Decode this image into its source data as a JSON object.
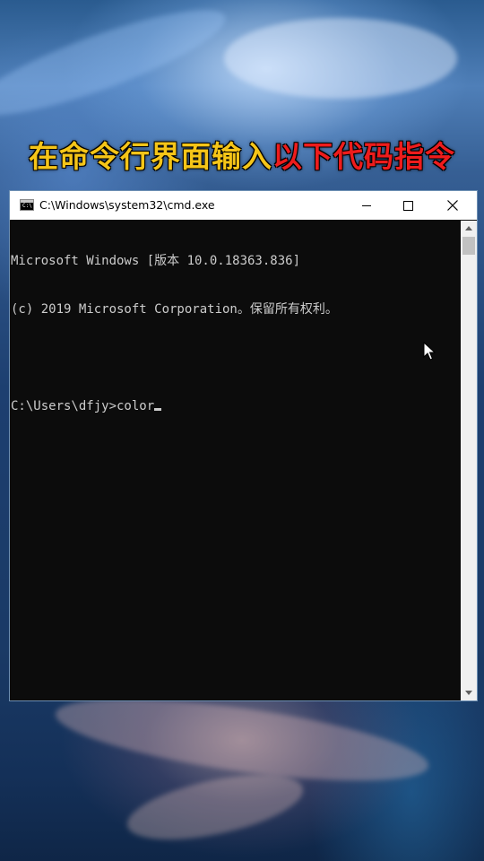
{
  "headline": {
    "part_yellow": "在命令行界面输入",
    "part_red": "以下代码指令"
  },
  "window": {
    "title": "C:\\Windows\\system32\\cmd.exe",
    "icon": "cmd-icon",
    "icon_text": "C:\\"
  },
  "console": {
    "lines": [
      "Microsoft Windows [版本 10.0.18363.836]",
      "(c) 2019 Microsoft Corporation。保留所有权利。",
      "",
      "C:\\Users\\dfjy>color"
    ]
  },
  "colors": {
    "headline_yellow": "#f5c518",
    "headline_red": "#ee1c1c",
    "console_bg": "#0c0c0c",
    "console_text": "#cccccc"
  }
}
